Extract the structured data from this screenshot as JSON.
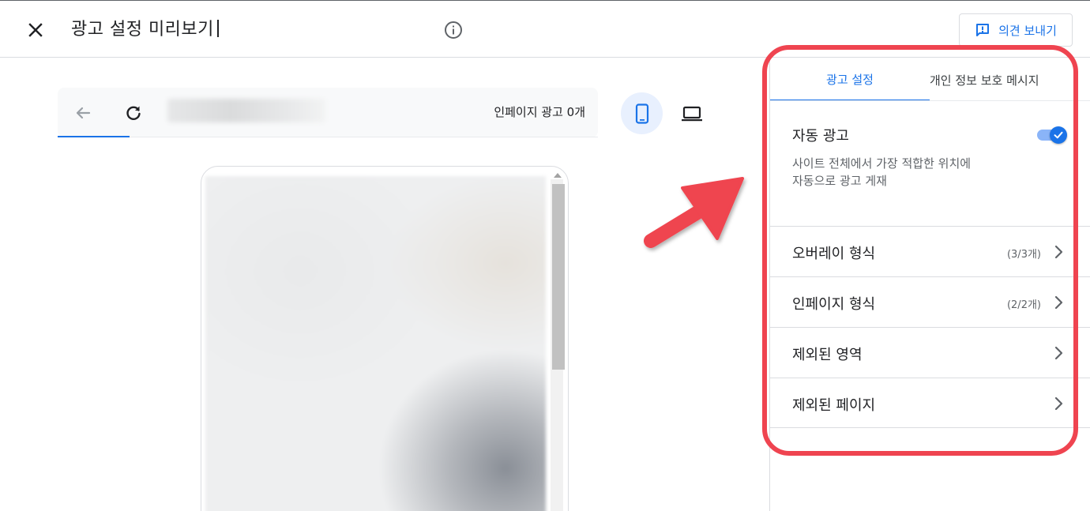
{
  "header": {
    "title": "광고 설정 미리보기",
    "feedback_label": "의견 보내기"
  },
  "browser": {
    "inpage_ads": "인페이지 광고 0개"
  },
  "panel": {
    "tabs": [
      {
        "label": "광고 설정",
        "active": true
      },
      {
        "label": "개인 정보 보호 메시지",
        "active": false
      }
    ],
    "auto_ads": {
      "title": "자동 광고",
      "desc_line1": "사이트 전체에서 가장 적합한 위치에",
      "desc_line2": "자동으로 광고 게재",
      "enabled": true
    },
    "items": [
      {
        "label": "오버레이 형식",
        "count": "(3/3개)"
      },
      {
        "label": "인페이지 형식",
        "count": "(2/2개)"
      },
      {
        "label": "제외된 영역",
        "count": ""
      },
      {
        "label": "제외된 페이지",
        "count": ""
      }
    ]
  },
  "colors": {
    "accent": "#1a73e8",
    "annotation": "#ef4450"
  },
  "icons": {
    "close": "close-icon",
    "info": "info-icon",
    "feedback": "feedback-icon",
    "back": "arrow-back-icon",
    "reload": "reload-icon",
    "mobile": "smartphone-icon",
    "desktop": "laptop-icon",
    "chevron": "chevron-right-icon",
    "check": "check-icon"
  }
}
